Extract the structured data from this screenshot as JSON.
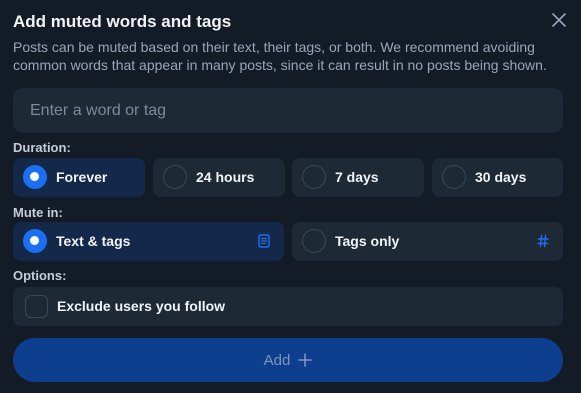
{
  "dialog": {
    "title": "Add muted words and tags",
    "description": "Posts can be muted based on their text, their tags, or both. We recommend avoiding common words that appear in many posts, since it can result in no posts being shown.",
    "close_icon": "close-icon"
  },
  "input": {
    "placeholder": "Enter a word or tag",
    "value": ""
  },
  "duration": {
    "label": "Duration:",
    "options": [
      {
        "label": "Forever",
        "selected": true
      },
      {
        "label": "24 hours",
        "selected": false
      },
      {
        "label": "7 days",
        "selected": false
      },
      {
        "label": "30 days",
        "selected": false
      }
    ]
  },
  "mute_in": {
    "label": "Mute in:",
    "options": [
      {
        "label": "Text & tags",
        "selected": true,
        "icon": "document-icon"
      },
      {
        "label": "Tags only",
        "selected": false,
        "icon": "hashtag-icon"
      }
    ]
  },
  "options": {
    "label": "Options:",
    "exclude_following": {
      "label": "Exclude users you follow",
      "checked": false
    }
  },
  "add_button": {
    "label": "Add",
    "icon": "plus-icon"
  },
  "colors": {
    "background": "#131b26",
    "field": "#1e2936",
    "selected_field": "#14284a",
    "accent": "#1d6ff2",
    "button": "#0e3f8f"
  }
}
